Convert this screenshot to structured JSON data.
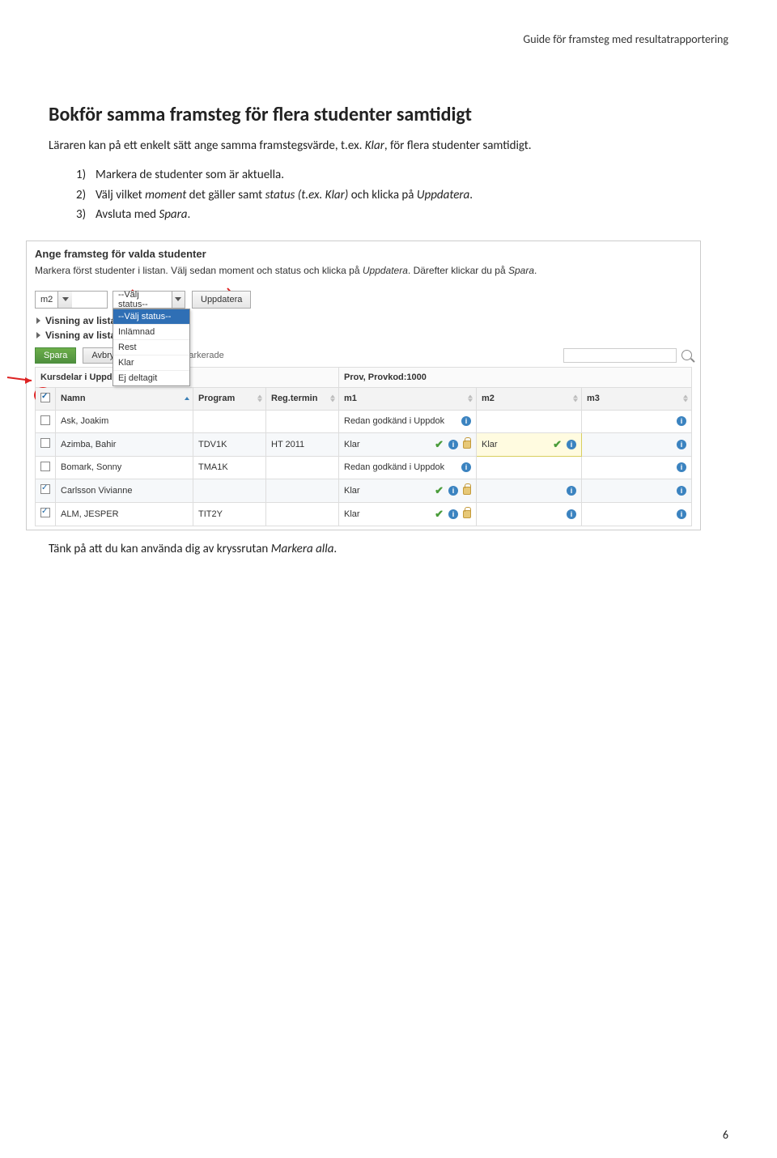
{
  "header": "Guide för framsteg med resultatrapportering",
  "h1": "Bokför samma framsteg för flera studenter samtidigt",
  "intro": {
    "before": "Läraren kan på ett enkelt sätt ange samma framstegsvärde, t.ex. ",
    "italic": "Klar",
    "after": ", för flera studenter samtidigt."
  },
  "steps": [
    {
      "n": "1)",
      "text": "Markera de studenter som är aktuella."
    },
    {
      "n": "2)",
      "prefix": "Välj vilket ",
      "i1": "moment",
      "mid1": " det gäller samt ",
      "i2": "status (t.ex. Klar)",
      "mid2": " och klicka på ",
      "i3": "Uppdatera",
      "suffix": "."
    },
    {
      "n": "3)",
      "prefix": "Avsluta med ",
      "i1": "Spara",
      "suffix": "."
    }
  ],
  "shot": {
    "title": "Ange framsteg för valda studenter",
    "instr1": "Markera först studenter i listan. Välj sedan moment och status och klicka på ",
    "instr_i1": "Uppdatera",
    "instr_mid": ". Därefter klickar du på ",
    "instr_i2": "Spara",
    "instr_end": ".",
    "m2": "m2",
    "valj": "--Välj status--",
    "update": "Uppdatera",
    "opts": [
      "--Välj status--",
      "Inlämnad",
      "Rest",
      "Klar",
      "Ej deltagit"
    ],
    "visn": "Visning av lista",
    "spara": "Spara",
    "avbryt": "Avbryt",
    "tag": "arkerade",
    "colgroup1": "Kursdelar i Uppdok",
    "colgroup2": "Prov, Provkod:1000",
    "cols": [
      "",
      "Namn",
      "Program",
      "Reg.termin",
      "m1",
      "m2",
      "m3"
    ],
    "rows": [
      {
        "chk": false,
        "name": "Ask, Joakim",
        "prog": "",
        "term": "",
        "m1": "Redan godkänd i Uppdok",
        "m1_icons": [
          "info"
        ],
        "m2": "",
        "m2_icons": [],
        "m3": "",
        "m3_icons": [
          "info"
        ]
      },
      {
        "chk": false,
        "name": "Azimba, Bahir",
        "prog": "TDV1K",
        "term": "HT 2011",
        "m1": "Klar",
        "m1_icons": [
          "tick",
          "info",
          "lock"
        ],
        "m2": "Klar",
        "m2_hl": true,
        "m2_icons": [
          "tick",
          "info"
        ],
        "m3": "",
        "m3_icons": [
          "info"
        ]
      },
      {
        "chk": false,
        "name": "Bomark, Sonny",
        "prog": "TMA1K",
        "term": "",
        "m1": "Redan godkänd i Uppdok",
        "m1_icons": [
          "info"
        ],
        "m2": "",
        "m2_icons": [],
        "m3": "",
        "m3_icons": [
          "info"
        ]
      },
      {
        "chk": true,
        "name": "Carlsson Vivianne",
        "prog": "",
        "term": "",
        "m1": "Klar",
        "m1_icons": [
          "tick",
          "info",
          "lock"
        ],
        "m2": "",
        "m2_icons": [
          "info"
        ],
        "m3": "",
        "m3_icons": [
          "info"
        ]
      },
      {
        "chk": true,
        "name": "ALM, JESPER",
        "prog": "TIT2Y",
        "term": "",
        "m1": "Klar",
        "m1_icons": [
          "tick",
          "info",
          "lock"
        ],
        "m2": "",
        "m2_icons": [
          "info"
        ],
        "m3": "",
        "m3_icons": [
          "info"
        ]
      }
    ]
  },
  "after": {
    "before": "Tänk på att du kan använda dig av kryssrutan ",
    "italic": "Markera alla",
    "after": "."
  },
  "pagenum": "6"
}
